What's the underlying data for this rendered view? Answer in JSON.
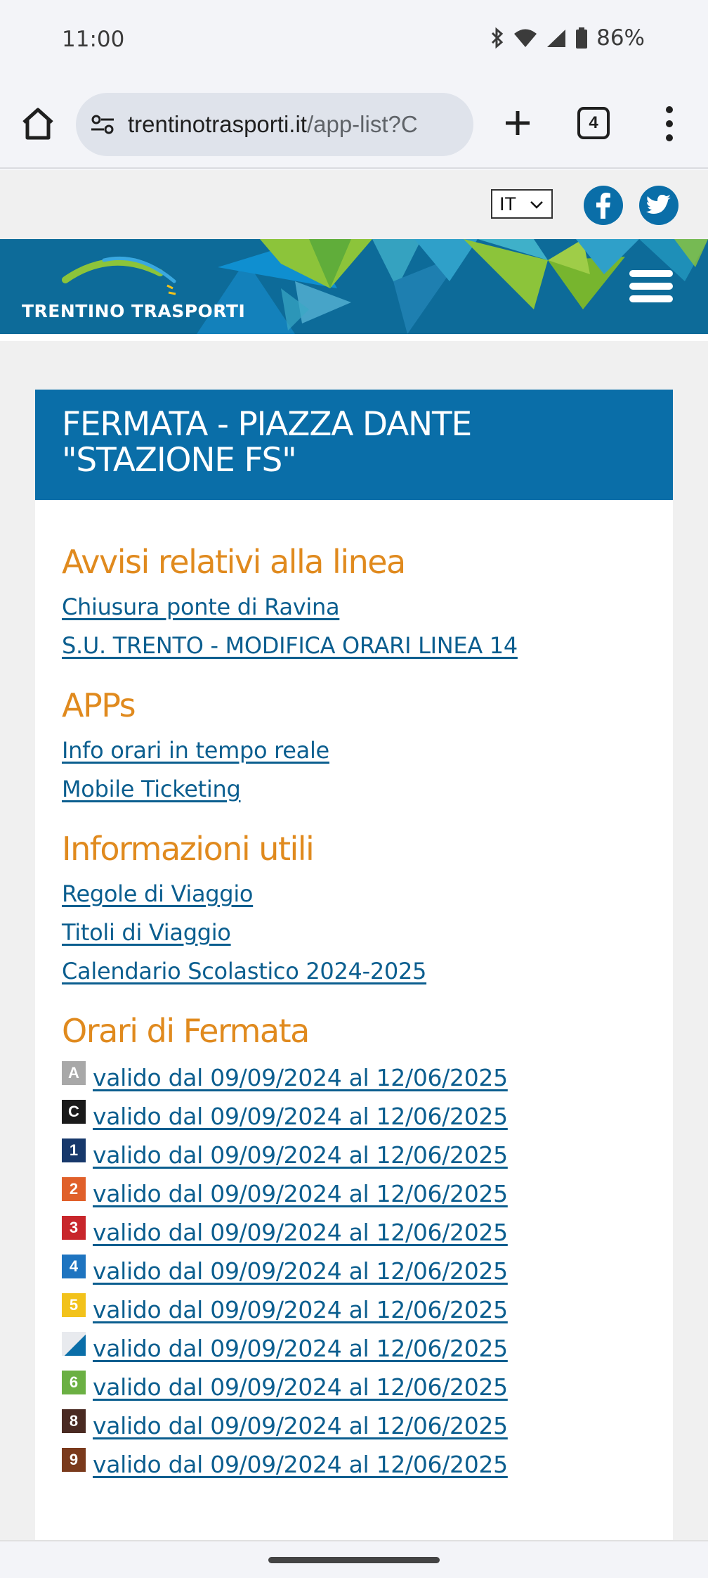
{
  "status_bar": {
    "time": "11:00",
    "battery": "86%",
    "icons": [
      "bluetooth-icon",
      "wifi-icon",
      "signal-icon",
      "battery-icon"
    ]
  },
  "browser": {
    "url_domain": "trentinotrasporti.it",
    "url_path": "/app-list?C",
    "tab_count": "4"
  },
  "site": {
    "language": "IT",
    "brand": "TRENTINO TRASPORTI",
    "colors": {
      "primary": "#0a6ea8",
      "accent": "#e08a1e",
      "link": "#0b5e8f"
    }
  },
  "card": {
    "title_line1": "FERMATA - PIAZZA DANTE",
    "title_line2": "\"STAZIONE FS\""
  },
  "sections": {
    "avvisi": {
      "heading": "Avvisi relativi alla linea",
      "links": [
        "Chiusura ponte di Ravina",
        "S.U. TRENTO - MODIFICA ORARI LINEA 14"
      ]
    },
    "apps": {
      "heading": "APPs",
      "links": [
        "Info orari in tempo reale",
        "Mobile Ticketing"
      ]
    },
    "info": {
      "heading": "Informazioni utili",
      "links": [
        "Regole di Viaggio",
        "Titoli di Viaggio",
        "Calendario Scolastico 2024-2025"
      ]
    },
    "orari": {
      "heading": "Orari di Fermata",
      "rows": [
        {
          "line": "A",
          "color": "#a8a8a8",
          "text": "valido dal 09/09/2024 al 12/06/2025"
        },
        {
          "line": "C",
          "color": "#1a1a1a",
          "text": "valido dal 09/09/2024 al 12/06/2025"
        },
        {
          "line": "1",
          "color": "#17386b",
          "text": "valido dal 09/09/2024 al 12/06/2025"
        },
        {
          "line": "2",
          "color": "#e0602a",
          "text": "valido dal 09/09/2024 al 12/06/2025"
        },
        {
          "line": "3",
          "color": "#c8262b",
          "text": "valido dal 09/09/2024 al 12/06/2025"
        },
        {
          "line": "4",
          "color": "#1e74c0",
          "text": "valido dal 09/09/2024 al 12/06/2025"
        },
        {
          "line": "5",
          "color": "#f2c21b",
          "text": "valido dal 09/09/2024 al 12/06/2025"
        },
        {
          "line": "",
          "color": "#e8eaee",
          "text": "valido dal 09/09/2024 al 12/06/2025"
        },
        {
          "line": "6",
          "color": "#6bb043",
          "text": "valido dal 09/09/2024 al 12/06/2025"
        },
        {
          "line": "8",
          "color": "#4a2a22",
          "text": "valido dal 09/09/2024 al 12/06/2025"
        },
        {
          "line": "9",
          "color": "#7a3a1c",
          "text": "valido dal 09/09/2024 al 12/06/2025"
        }
      ]
    }
  }
}
